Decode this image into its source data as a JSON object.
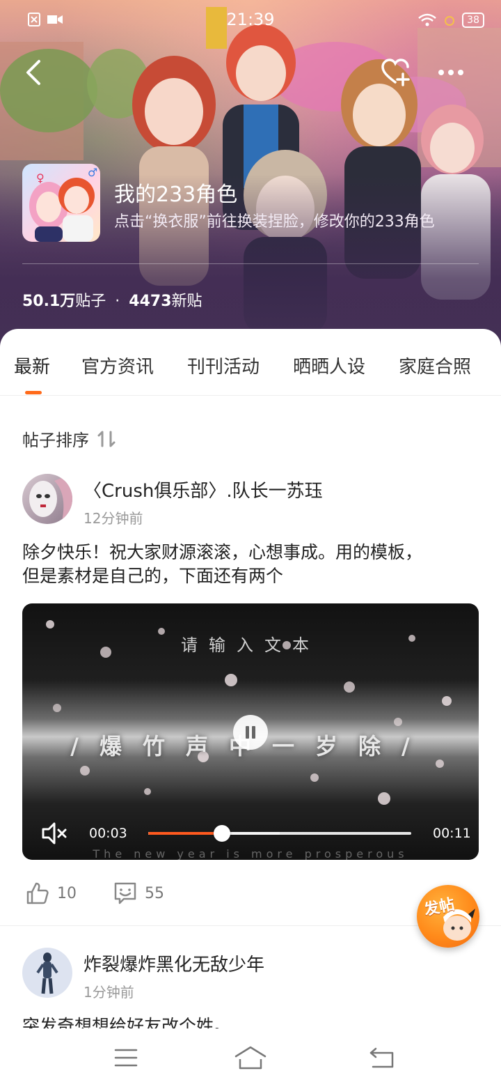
{
  "status_bar": {
    "time": "21:39",
    "battery": "38"
  },
  "header": {
    "game_title": "我的233角色",
    "game_desc": "点击“换衣服”前往换装捏脸，修改你的233角色",
    "stats": {
      "posts_count": "50.1万",
      "posts_label": "贴子",
      "separator": "·",
      "new_count": "4473",
      "new_label": "新贴"
    }
  },
  "tabs": [
    {
      "label": "最新",
      "active": true
    },
    {
      "label": "官方资讯",
      "active": false
    },
    {
      "label": "刊刊活动",
      "active": false
    },
    {
      "label": "晒晒人设",
      "active": false
    },
    {
      "label": "家庭合照",
      "active": false
    }
  ],
  "sort": {
    "label": "帖子排序"
  },
  "posts": [
    {
      "author": "〈Crush俱乐部〉.队长一苏珏",
      "time": "12分钟前",
      "text_line1": "除夕快乐！祝大家财源滚滚，心想事成。用的模板，",
      "text_line2": "但是素材是自己的，下面还有两个",
      "video": {
        "overlay_top": "请输入文本",
        "overlay_main": "/爆竹声中一岁除/",
        "overlay_sub": "The new year is more prosperous",
        "current_time": "00:03",
        "total_time": "00:11",
        "progress": 0.28,
        "buffered": 0.5,
        "muted": true,
        "playing": true
      },
      "likes": "10",
      "comments": "55"
    },
    {
      "author": "炸裂爆炸黑化无敌少年",
      "time": "1分钟前",
      "text_line1": "突发奇想想给好友改个姓。"
    }
  ],
  "fab": {
    "label": "发帖"
  },
  "colors": {
    "accent": "#ff6a1a",
    "progress": "#ff5a1f"
  },
  "icons": {
    "back": "chevron-left-icon",
    "favorite": "heart-plus-icon",
    "more": "more-dots-icon",
    "sort": "sort-arrows-icon",
    "like": "thumb-up-icon",
    "comment": "comment-smile-icon",
    "mute": "volume-mute-icon",
    "nav_menu": "menu-icon",
    "nav_home": "home-icon",
    "nav_back": "back-arrow-icon"
  }
}
